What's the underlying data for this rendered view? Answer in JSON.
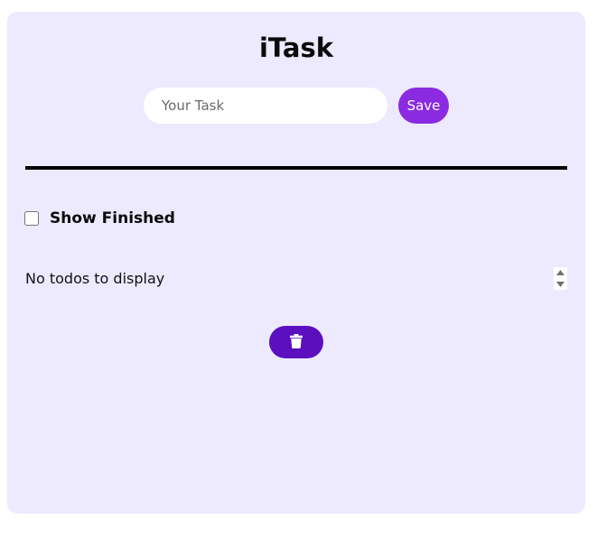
{
  "app": {
    "title": "iTask"
  },
  "add_task": {
    "placeholder": "Your Task",
    "value": "",
    "save_label": "Save"
  },
  "filter": {
    "show_finished_label": "Show Finished",
    "show_finished_checked": false
  },
  "todos": {
    "items": [],
    "empty_message": "No todos to display"
  },
  "icons": {
    "delete": "trash-icon",
    "scroll_up": "chevron-up-icon",
    "scroll_down": "chevron-down-icon"
  },
  "colors": {
    "card_background": "#ede9fe",
    "save_button": "#8a2be2",
    "delete_button": "#5b0fbf",
    "divider": "#000000"
  }
}
